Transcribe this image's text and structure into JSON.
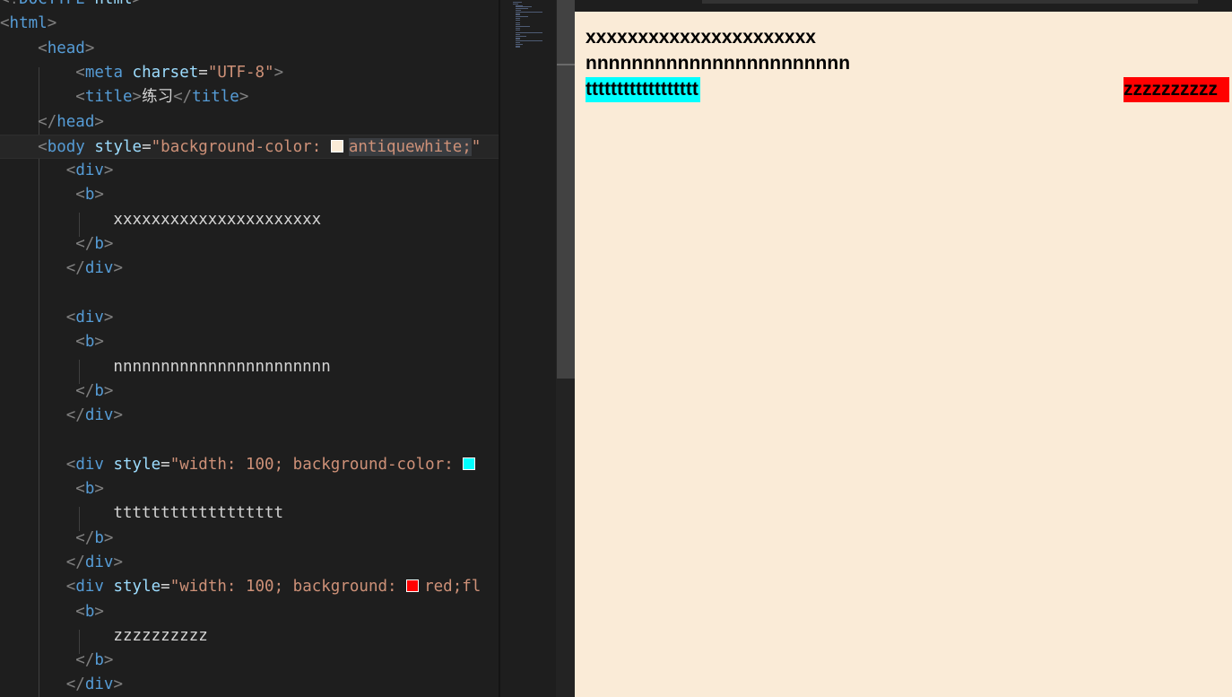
{
  "editor": {
    "lines": [
      [
        [
          "t-br",
          "<"
        ],
        [
          "t-br",
          "!"
        ],
        [
          "t-tag",
          "DOCTYPE"
        ],
        [
          "t-attr",
          " html"
        ],
        [
          "t-br",
          ">"
        ]
      ],
      [
        [
          "t-br",
          "<"
        ],
        [
          "t-tag",
          "html"
        ],
        [
          "t-br",
          ">"
        ]
      ],
      [
        [
          "t-txt",
          "    "
        ],
        [
          "t-br",
          "<"
        ],
        [
          "t-tag",
          "head"
        ],
        [
          "t-br",
          ">"
        ]
      ],
      [
        [
          "t-txt",
          "        "
        ],
        [
          "t-br",
          "<"
        ],
        [
          "t-tag",
          "meta"
        ],
        [
          "t-attr",
          " charset"
        ],
        [
          "t-txt",
          "="
        ],
        [
          "t-str",
          "\"UTF-8\""
        ],
        [
          "t-br",
          ">"
        ]
      ],
      [
        [
          "t-txt",
          "        "
        ],
        [
          "t-br",
          "<"
        ],
        [
          "t-tag",
          "title"
        ],
        [
          "t-br",
          ">"
        ],
        [
          "t-txt",
          "练习"
        ],
        [
          "t-br",
          "</"
        ],
        [
          "t-tag",
          "title"
        ],
        [
          "t-br",
          ">"
        ]
      ],
      [
        [
          "t-txt",
          "    "
        ],
        [
          "t-br",
          "</"
        ],
        [
          "t-tag",
          "head"
        ],
        [
          "t-br",
          ">"
        ]
      ],
      [
        [
          "t-txt",
          "    "
        ],
        [
          "t-br",
          "<"
        ],
        [
          "t-tag",
          "body"
        ],
        [
          "t-attr",
          " style"
        ],
        [
          "t-txt",
          "="
        ],
        [
          "t-str",
          "\"background-color: "
        ],
        [
          "swatch",
          "#faebd7"
        ],
        [
          "hl",
          "antiquewhite;"
        ],
        [
          "t-str",
          "\""
        ]
      ],
      [
        [
          "t-txt",
          "       "
        ],
        [
          "t-br",
          "<"
        ],
        [
          "t-tag",
          "div"
        ],
        [
          "t-br",
          ">"
        ]
      ],
      [
        [
          "t-txt",
          "        "
        ],
        [
          "t-br",
          "<"
        ],
        [
          "t-tag",
          "b"
        ],
        [
          "t-br",
          ">"
        ]
      ],
      [
        [
          "t-txt",
          "            xxxxxxxxxxxxxxxxxxxxxx"
        ]
      ],
      [
        [
          "t-txt",
          "        "
        ],
        [
          "t-br",
          "</"
        ],
        [
          "t-tag",
          "b"
        ],
        [
          "t-br",
          ">"
        ]
      ],
      [
        [
          "t-txt",
          "       "
        ],
        [
          "t-br",
          "</"
        ],
        [
          "t-tag",
          "div"
        ],
        [
          "t-br",
          ">"
        ]
      ],
      [],
      [
        [
          "t-txt",
          "       "
        ],
        [
          "t-br",
          "<"
        ],
        [
          "t-tag",
          "div"
        ],
        [
          "t-br",
          ">"
        ]
      ],
      [
        [
          "t-txt",
          "        "
        ],
        [
          "t-br",
          "<"
        ],
        [
          "t-tag",
          "b"
        ],
        [
          "t-br",
          ">"
        ]
      ],
      [
        [
          "t-txt",
          "            nnnnnnnnnnnnnnnnnnnnnnn"
        ]
      ],
      [
        [
          "t-txt",
          "        "
        ],
        [
          "t-br",
          "</"
        ],
        [
          "t-tag",
          "b"
        ],
        [
          "t-br",
          ">"
        ]
      ],
      [
        [
          "t-txt",
          "       "
        ],
        [
          "t-br",
          "</"
        ],
        [
          "t-tag",
          "div"
        ],
        [
          "t-br",
          ">"
        ]
      ],
      [],
      [
        [
          "t-txt",
          "       "
        ],
        [
          "t-br",
          "<"
        ],
        [
          "t-tag",
          "div"
        ],
        [
          "t-attr",
          " style"
        ],
        [
          "t-txt",
          "="
        ],
        [
          "t-str",
          "\"width: 100; background-color: "
        ],
        [
          "swatch",
          "#00ffff"
        ]
      ],
      [
        [
          "t-txt",
          "        "
        ],
        [
          "t-br",
          "<"
        ],
        [
          "t-tag",
          "b"
        ],
        [
          "t-br",
          ">"
        ]
      ],
      [
        [
          "t-txt",
          "            tttttttttttttttttt"
        ]
      ],
      [
        [
          "t-txt",
          "        "
        ],
        [
          "t-br",
          "</"
        ],
        [
          "t-tag",
          "b"
        ],
        [
          "t-br",
          ">"
        ]
      ],
      [
        [
          "t-txt",
          "       "
        ],
        [
          "t-br",
          "</"
        ],
        [
          "t-tag",
          "div"
        ],
        [
          "t-br",
          ">"
        ]
      ],
      [
        [
          "t-txt",
          "       "
        ],
        [
          "t-br",
          "<"
        ],
        [
          "t-tag",
          "div"
        ],
        [
          "t-attr",
          " style"
        ],
        [
          "t-txt",
          "="
        ],
        [
          "t-str",
          "\"width: 100; background: "
        ],
        [
          "swatch",
          "#ff0000"
        ],
        [
          "t-str",
          "red;fl"
        ]
      ],
      [
        [
          "t-txt",
          "        "
        ],
        [
          "t-br",
          "<"
        ],
        [
          "t-tag",
          "b"
        ],
        [
          "t-br",
          ">"
        ]
      ],
      [
        [
          "t-txt",
          "            zzzzzzzzzz"
        ]
      ],
      [
        [
          "t-txt",
          "        "
        ],
        [
          "t-br",
          "</"
        ],
        [
          "t-tag",
          "b"
        ],
        [
          "t-br",
          ">"
        ]
      ],
      [
        [
          "t-txt",
          "       "
        ],
        [
          "t-br",
          "</"
        ],
        [
          "t-tag",
          "div"
        ],
        [
          "t-br",
          ">"
        ]
      ]
    ]
  },
  "preview": {
    "line_x": "xxxxxxxxxxxxxxxxxxxxxx",
    "line_n": "nnnnnnnnnnnnnnnnnnnnnnn",
    "line_t": "tttttttttttttttttt",
    "line_z": "zzzzzzzzzz",
    "background": "#faebd7",
    "t_background": "#00ffff",
    "z_background": "#ff0000"
  }
}
